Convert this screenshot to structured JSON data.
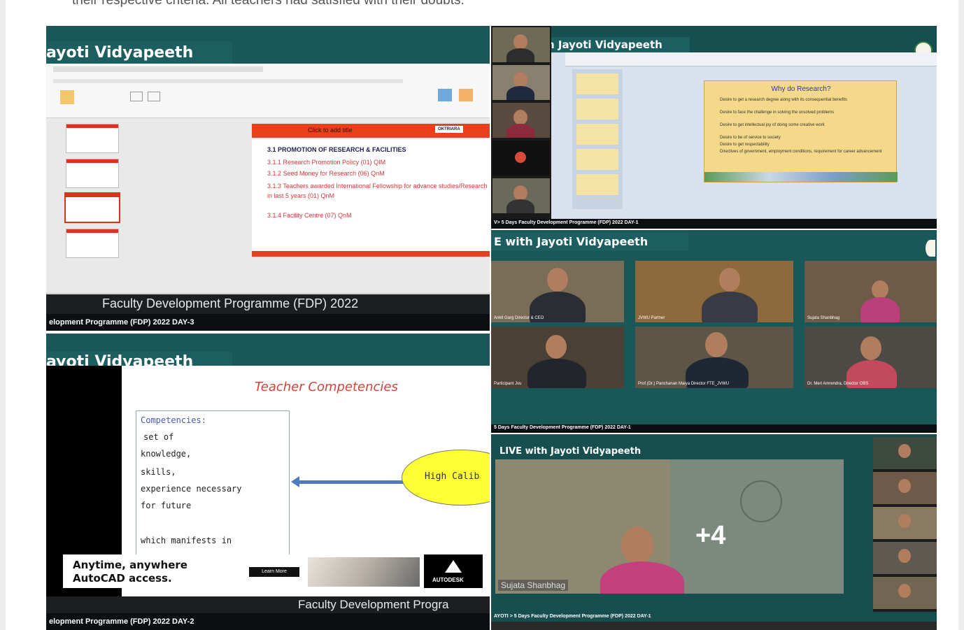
{
  "post_caption": "their respective criteria. All teachers had satisfied with their doubts.",
  "tile1": {
    "banner": "ayoti Vidyapeeth",
    "slide_title": "Click to add title",
    "logo_text": "OKTRIARA",
    "heading": "3.1 PROMOTION OF RESEARCH & FACILITIES",
    "items": [
      "3.1.1 Research Promotion Policy (01) QIM",
      "3.1.2 Seed Money for Research (06) QnM",
      "3.1.3 Teachers awarded International Fellowship for advance studies/Research in last 5 years (01) QnM",
      "3.1.4 Facility Centre (07) QnM"
    ],
    "footer": "Faculty Development Programme (FDP) 2022",
    "ticker": "elopment Programme (FDP) 2022 DAY-3"
  },
  "tile2": {
    "banner": "h Jayoti Vidyapeeth",
    "slide_title": "Why do Research?",
    "bullets": [
      "Desire to get a research degree along with its consequential benefits",
      "Desire to face the challenge in solving the unsolved problems",
      "Desire to get intellectual joy of doing some creative work",
      "Desire to be of service to society",
      "Desire to get respectability",
      "Directives of government, employment conditions, requirement for career advancement"
    ],
    "ticker": "V> 5 Days Faculty Development Programme (FDP) 2022 DAY-1"
  },
  "tile3": {
    "banner": "E with Jayoti Vidyapeeth",
    "participants": [
      "Ankit Garg Director & CEO",
      "JVWU Partner",
      "Sujata Shanbhag",
      "Participant Jvu",
      "Prof.(Dr.) Panchanan Maiya Director FTE_JVWU",
      "Dr. Meri Amrendra, Director OBS"
    ],
    "ticker": "5 Days Faculty Development Programme (FDP) 2022 DAY-1"
  },
  "tile4": {
    "banner": "ayoti Vidyapeeth",
    "slide_title": "Teacher Competencies",
    "box_lines": [
      "Competencies:",
      "set of",
      "knowledge,",
      "skills,",
      "experience necessary",
      "for future",
      "",
      "which manifests in"
    ],
    "bubble": "High Calib",
    "ad_line1": "Anytime, anywhere",
    "ad_line2": "AutoCAD access.",
    "ad_button": "Learn More",
    "ad_brand": "AUTODESK",
    "footer": "Faculty Development Progra",
    "ticker": "elopment Programme (FDP) 2022 DAY-2"
  },
  "tile5": {
    "banner": "LIVE with Jayoti Vidyapeeth",
    "speaker": "Sujata Shanbhag",
    "more_count": "+4",
    "ticker": "AYOTI > 5 Days Faculty Development Programme (FDP) 2022 DAY-1"
  }
}
